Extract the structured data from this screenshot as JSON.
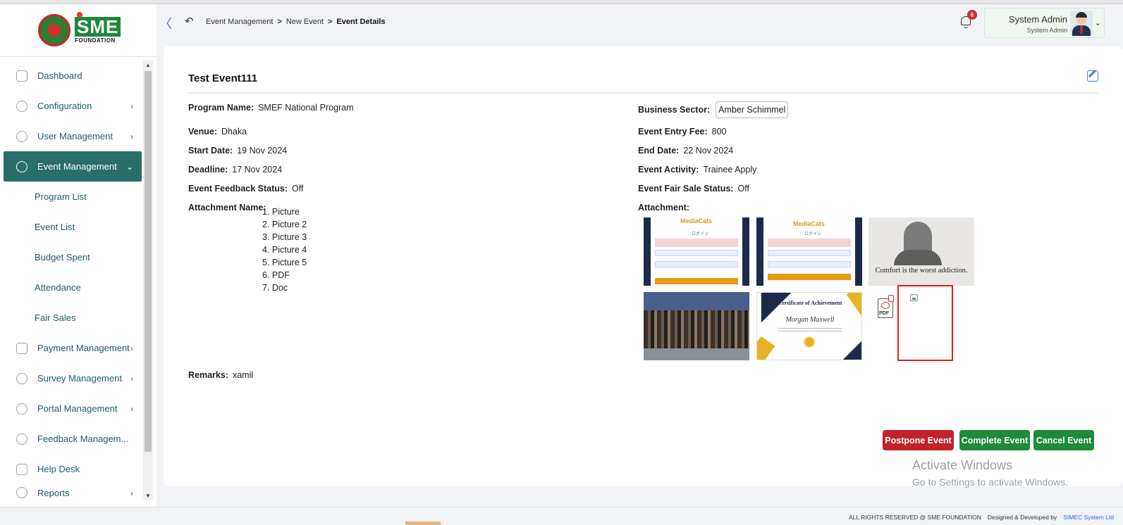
{
  "brand": {
    "logo_text": "SME",
    "logo_sub": "FOUNDATION"
  },
  "sidebar": {
    "items": [
      {
        "label": "Dashboard",
        "icon": "grid-icon",
        "has_chevron": false
      },
      {
        "label": "Configuration",
        "icon": "gears-icon",
        "has_chevron": true
      },
      {
        "label": "User Management",
        "icon": "dollar-icon",
        "has_chevron": true
      },
      {
        "label": "Event Management",
        "icon": "lock-icon",
        "has_chevron": true,
        "active": true
      }
    ],
    "subitems": [
      "Program List",
      "Event List",
      "Budget Spent",
      "Attendance",
      "Fair Sales"
    ],
    "items_after": [
      {
        "label": "Payment Management",
        "icon": "payment-icon",
        "has_chevron": true
      },
      {
        "label": "Survey Management",
        "icon": "chart-icon",
        "has_chevron": true
      },
      {
        "label": "Portal Management",
        "icon": "lock-icon",
        "has_chevron": true
      },
      {
        "label": "Feedback Managem...",
        "icon": "feedback-icon",
        "has_chevron": false
      },
      {
        "label": "Help Desk",
        "icon": "mail-icon",
        "has_chevron": false
      },
      {
        "label": "Reports",
        "icon": "report-icon",
        "has_chevron": true
      }
    ],
    "chevron_right": "›",
    "chevron_down": "⌄"
  },
  "header": {
    "collapse_glyph": "〈",
    "back_glyph": "↶",
    "breadcrumb": [
      "Event Management",
      "New Event",
      "Event Details"
    ],
    "breadcrumb_sep": ">",
    "notification_count": "6",
    "user_name": "System Admin",
    "user_role": "System Admin",
    "user_chevron": "⌄"
  },
  "event": {
    "title": "Test Event111",
    "program_name_label": "Program Name:",
    "program_name": "SMEF National Program",
    "business_sector_label": "Business Sector:",
    "business_sector": "Amber Schimmel",
    "venue_label": "Venue:",
    "venue": "Dhaka",
    "entry_fee_label": "Event Entry Fee:",
    "entry_fee": "800",
    "start_date_label": "Start Date:",
    "start_date": "19 Nov 2024",
    "end_date_label": "End Date:",
    "end_date": "22 Nov 2024",
    "deadline_label": "Deadline:",
    "deadline": "17 Nov 2024",
    "activity_label": "Event Activity:",
    "activity": "Trainee Apply",
    "feedback_status_label": "Event Feedback Status:",
    "feedback_status": "Off",
    "fair_sale_label": "Event Fair Sale Status:",
    "fair_sale": "Off",
    "attachment_name_label": "Attachment Name:",
    "attachment_names": [
      "1. Picture",
      "2. Picture 2",
      "3. Picture 3",
      "4. Picture 4",
      "5. Picture 5",
      "6. PDF",
      "7. Doc"
    ],
    "attachment_label": "Attachment:",
    "remarks_label": "Remarks:",
    "remarks": "xamil"
  },
  "thumbnails": {
    "login_brand": "MediaCats",
    "login_sub": "ログイン",
    "quote_text": "Comfort is the worst addiction.",
    "cert_title": "Certificate of Achievement",
    "cert_name": "Morgan Maxwell",
    "pdf_label": "PDF"
  },
  "actions": {
    "postpone": "Postpone Event",
    "complete": "Complete Event",
    "cancel": "Cancel Event"
  },
  "watermark": {
    "title": "Activate Windows",
    "subtitle": "Go to Settings to activate Windows."
  },
  "footer": {
    "rights": "ALL RIGHTS RESERVED @ SME FOUNDATION",
    "designed_by": "Designed & Developed by",
    "company": "SIMEC System Ltd"
  },
  "colors": {
    "active_menu": "#2a6e6a",
    "postpone": "#c0232b",
    "complete": "#1e8a3a",
    "cancel": "#1e8a3a",
    "badge": "#d32f2f"
  }
}
